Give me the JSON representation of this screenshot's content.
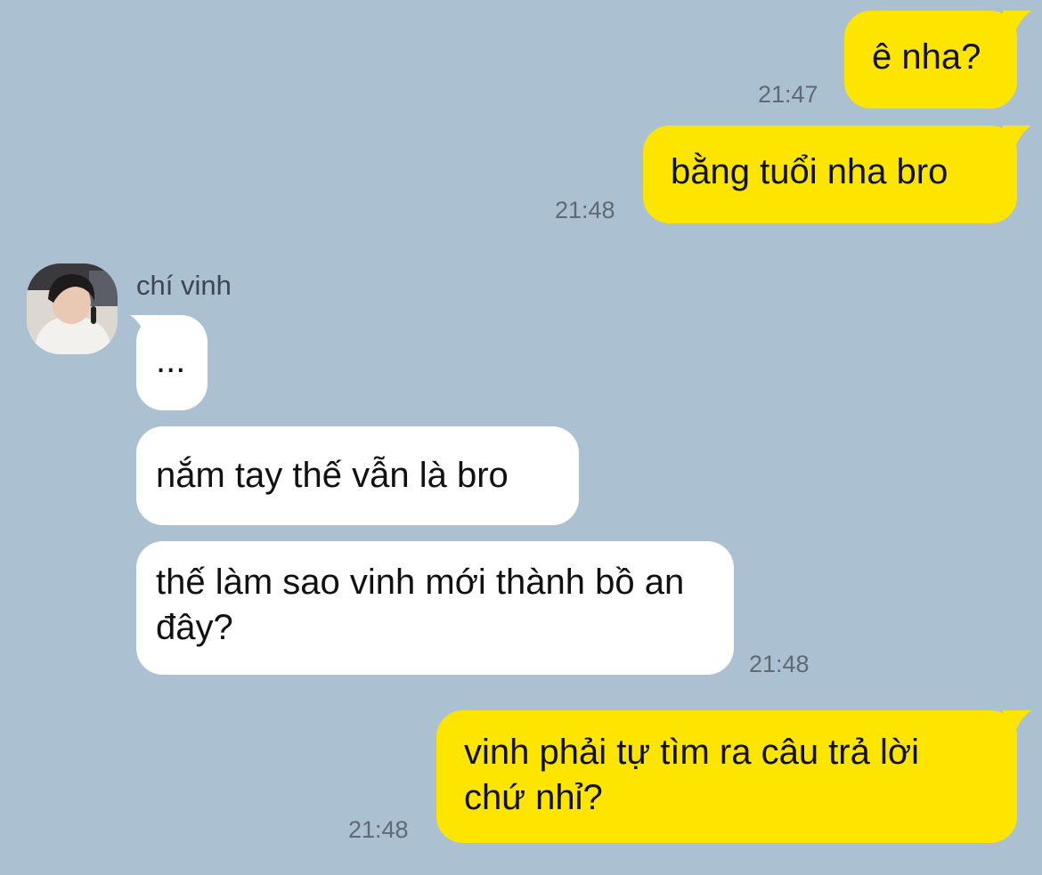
{
  "colors": {
    "background": "#abc1d1",
    "outgoing_bubble": "#fee500",
    "incoming_bubble": "#ffffff",
    "timestamp": "#5f6a74"
  },
  "contact": {
    "name": "chí vinh",
    "avatar_icon": "profile-photo-avatar"
  },
  "messages": [
    {
      "from": "me",
      "text": "ê nha?",
      "time": "21:47"
    },
    {
      "from": "me",
      "text": "bằng tuổi nha bro",
      "time": "21:48"
    },
    {
      "from": "them",
      "text": "...",
      "time": ""
    },
    {
      "from": "them",
      "text": "nắm tay thế vẫn là bro",
      "time": ""
    },
    {
      "from": "them",
      "text": "thế làm sao vinh mới thành bồ an đây?",
      "time": "21:48"
    },
    {
      "from": "me",
      "text": "vinh phải tự tìm ra câu trả lời chứ nhỉ?",
      "time": "21:48"
    }
  ]
}
